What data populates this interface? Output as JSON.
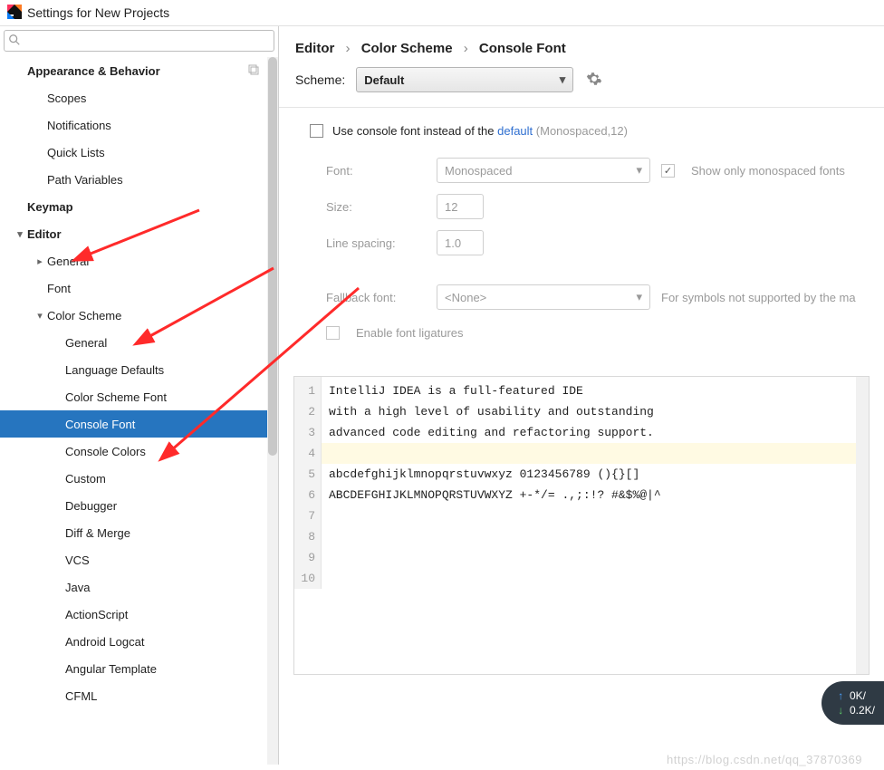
{
  "window": {
    "title": "Settings for New Projects"
  },
  "search": {
    "placeholder": ""
  },
  "sidebar": {
    "appearance": "Appearance & Behavior",
    "scopes": "Scopes",
    "notifications": "Notifications",
    "quick_lists": "Quick Lists",
    "path_variables": "Path Variables",
    "keymap": "Keymap",
    "editor": "Editor",
    "general": "General",
    "font": "Font",
    "color_scheme": "Color Scheme",
    "cs_general": "General",
    "cs_lang_defaults": "Language Defaults",
    "cs_font": "Color Scheme Font",
    "cs_console_font": "Console Font",
    "cs_console_colors": "Console Colors",
    "cs_custom": "Custom",
    "cs_debugger": "Debugger",
    "cs_diff": "Diff & Merge",
    "cs_vcs": "VCS",
    "cs_java": "Java",
    "cs_actionscript": "ActionScript",
    "cs_android_logcat": "Android Logcat",
    "cs_angular": "Angular Template",
    "cs_cfml": "CFML"
  },
  "crumbs": {
    "a": "Editor",
    "b": "Color Scheme",
    "c": "Console Font"
  },
  "scheme": {
    "label": "Scheme:",
    "value": "Default"
  },
  "use_console": {
    "prefix": "Use console font instead of the ",
    "link": "default",
    "suffix": " (Monospaced,12)"
  },
  "form": {
    "font_label": "Font:",
    "font_value": "Monospaced",
    "show_mono": "Show only monospaced fonts",
    "size_label": "Size:",
    "size_value": "12",
    "spacing_label": "Line spacing:",
    "spacing_value": "1.0",
    "fallback_label": "Fallback font:",
    "fallback_value": "<None>",
    "fallback_hint": "For symbols not supported by the ma",
    "ligatures": "Enable font ligatures"
  },
  "preview": {
    "lines": [
      "IntelliJ IDEA is a full-featured IDE",
      "with a high level of usability and outstanding",
      "advanced code editing and refactoring support.",
      "",
      "abcdefghijklmnopqrstuvwxyz 0123456789 (){}[]",
      "ABCDEFGHIJKLMNOPQRSTUVWXYZ +-*/= .,;:!? #&$%@|^",
      "",
      "",
      "",
      ""
    ],
    "caret_line_index": 3
  },
  "net": {
    "up": "0K/",
    "down": "0.2K/"
  },
  "watermark": "https://blog.csdn.net/qq_37870369"
}
